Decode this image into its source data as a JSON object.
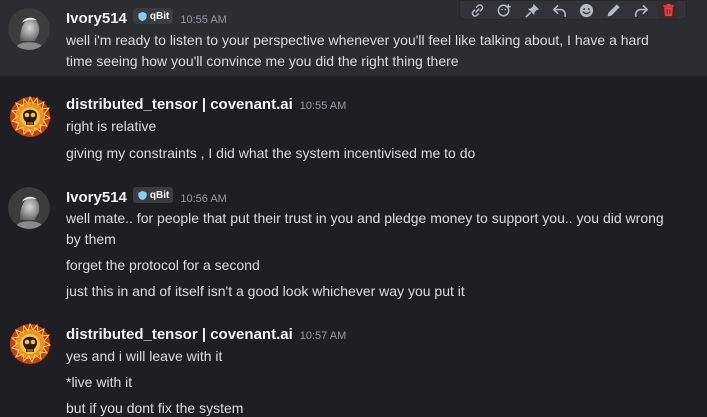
{
  "colors": {
    "background": "#1f1f23",
    "hover_background": "#2b2d31",
    "username": "#f2f3f5",
    "timestamp": "#949ba4",
    "message_text": "#dbdee1",
    "badge_shield": "#8ecbf0",
    "danger": "#f23f43"
  },
  "toolbar": {
    "icons": [
      "link-icon",
      "add-reaction-icon",
      "pin-icon",
      "reply-icon",
      "emoji-icon",
      "edit-icon",
      "forward-icon",
      "delete-icon"
    ]
  },
  "messages": [
    {
      "username": "Ivory514",
      "badge": "qBit",
      "timestamp": "10:55 AM",
      "lines": [
        "well i'm ready to listen to your perspective whenever you'll feel like talking about, I have a hard time seeing how you'll convince me you did the right thing there"
      ]
    },
    {
      "username": "distributed_tensor | covenant.ai",
      "timestamp": "10:55 AM",
      "lines": [
        "right is relative",
        "giving my constraints , I did what the system incentivised me to do"
      ]
    },
    {
      "username": "Ivory514",
      "badge": "qBit",
      "timestamp": "10:56 AM",
      "lines": [
        "well mate.. for people that put their trust in you and pledge money to support you.. you did wrong by them",
        "forget the protocol for a second",
        "just this in and of itself isn't a good look whichever way you put it"
      ]
    },
    {
      "username": "distributed_tensor | covenant.ai",
      "timestamp": "10:57 AM",
      "lines": [
        "yes and i will leave with it",
        "*live with it",
        "but if you dont fix the system"
      ]
    }
  ]
}
